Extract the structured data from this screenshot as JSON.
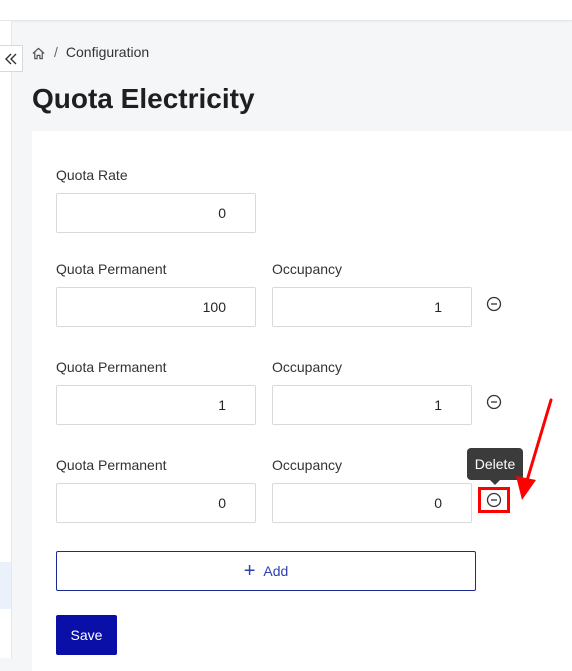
{
  "breadcrumb": {
    "home_icon": "home-icon",
    "separator": "/",
    "current": "Configuration"
  },
  "page": {
    "title": "Quota Electricity"
  },
  "form": {
    "quota_rate": {
      "label": "Quota Rate",
      "value": "0"
    },
    "rows": [
      {
        "quota_permanent_label": "Quota Permanent",
        "quota_permanent_value": "100",
        "occupancy_label": "Occupancy",
        "occupancy_value": "1"
      },
      {
        "quota_permanent_label": "Quota Permanent",
        "quota_permanent_value": "1",
        "occupancy_label": "Occupancy",
        "occupancy_value": "1"
      },
      {
        "quota_permanent_label": "Quota Permanent",
        "quota_permanent_value": "0",
        "occupancy_label": "Occupancy",
        "occupancy_value": "0"
      }
    ],
    "add_label": "Add",
    "save_label": "Save"
  },
  "tooltip": {
    "text": "Delete"
  },
  "colors": {
    "primary": "#0a0fa8",
    "annotation": "#ff0000",
    "tooltip_bg": "#3b3b3b"
  }
}
